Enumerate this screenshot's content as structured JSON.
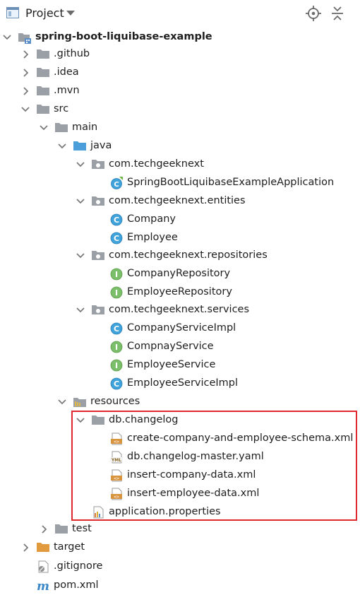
{
  "header": {
    "title": "Project",
    "dropdown_icon": "chevron-down-icon",
    "locate_icon": "crosshair-icon",
    "collapse_icon": "collapse-all-icon"
  },
  "colors": {
    "folder": "#9aa0a6",
    "source_folder": "#4a9fd9",
    "excluded_folder": "#e09a3e",
    "class_icon": "#40a3d9",
    "interface_icon": "#7cbf6a",
    "xml_icon": "#d99440",
    "highlight_border": "#e0292e"
  },
  "tree": [
    {
      "label": "spring-boot-liquibase-example",
      "icon": "module-icon",
      "expanded": true
    },
    {
      "label": ".github",
      "icon": "folder-icon",
      "expanded": false
    },
    {
      "label": ".idea",
      "icon": "folder-icon",
      "expanded": false
    },
    {
      "label": ".mvn",
      "icon": "folder-icon",
      "expanded": false
    },
    {
      "label": "src",
      "icon": "folder-icon",
      "expanded": true
    },
    {
      "label": "main",
      "icon": "folder-icon",
      "expanded": true
    },
    {
      "label": "java",
      "icon": "source-folder-icon",
      "expanded": true
    },
    {
      "label": "com.techgeeknext",
      "icon": "package-icon",
      "expanded": true
    },
    {
      "label": "SpringBootLiquibaseExampleApplication",
      "icon": "spring-boot-class-icon"
    },
    {
      "label": "com.techgeeknext.entities",
      "icon": "package-icon",
      "expanded": true
    },
    {
      "label": "Company",
      "icon": "class-icon"
    },
    {
      "label": "Employee",
      "icon": "class-icon"
    },
    {
      "label": "com.techgeeknext.repositories",
      "icon": "package-icon",
      "expanded": true
    },
    {
      "label": "CompanyRepository",
      "icon": "interface-icon"
    },
    {
      "label": "EmployeeRepository",
      "icon": "interface-icon"
    },
    {
      "label": "com.techgeeknext.services",
      "icon": "package-icon",
      "expanded": true
    },
    {
      "label": "CompanyServiceImpl",
      "icon": "class-icon"
    },
    {
      "label": "CompnayService",
      "icon": "interface-icon"
    },
    {
      "label": "EmployeeService",
      "icon": "interface-icon"
    },
    {
      "label": "EmployeeServiceImpl",
      "icon": "class-icon"
    },
    {
      "label": "resources",
      "icon": "resources-folder-icon",
      "expanded": true
    },
    {
      "label": "db.changelog",
      "icon": "folder-icon",
      "expanded": true
    },
    {
      "label": "create-company-and-employee-schema.xml",
      "icon": "xml-file-icon"
    },
    {
      "label": "db.changelog-master.yaml",
      "icon": "yaml-file-icon"
    },
    {
      "label": "insert-company-data.xml",
      "icon": "xml-file-icon"
    },
    {
      "label": "insert-employee-data.xml",
      "icon": "xml-file-icon"
    },
    {
      "label": "application.properties",
      "icon": "properties-file-icon"
    },
    {
      "label": "test",
      "icon": "folder-icon",
      "expanded": false
    },
    {
      "label": "target",
      "icon": "excluded-folder-icon",
      "expanded": false
    },
    {
      "label": ".gitignore",
      "icon": "gitignore-file-icon"
    },
    {
      "label": "pom.xml",
      "icon": "maven-file-icon"
    }
  ]
}
